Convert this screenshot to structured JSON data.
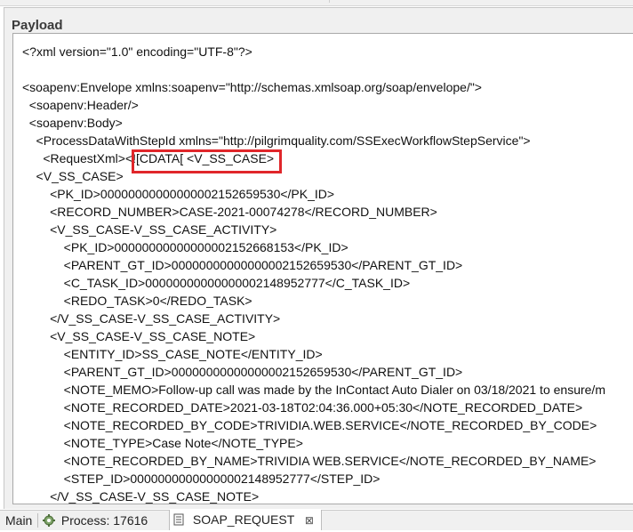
{
  "panel": {
    "title": "Payload"
  },
  "payload_lines": [
    "<?xml version=\"1.0\" encoding=\"UTF-8\"?>",
    "",
    "<soapenv:Envelope xmlns:soapenv=\"http://schemas.xmlsoap.org/soap/envelope/\">",
    "  <soapenv:Header/>",
    "  <soapenv:Body>",
    "    <ProcessDataWithStepId xmlns=\"http://pilgrimquality.com/SSExecWorkflowStepService\">",
    "      <RequestXml><![CDATA[ <V_SS_CASE>",
    "    <V_SS_CASE>",
    "        <PK_ID>00000000000000002152659530</PK_ID>",
    "        <RECORD_NUMBER>CASE-2021-00074278</RECORD_NUMBER>",
    "        <V_SS_CASE-V_SS_CASE_ACTIVITY>",
    "            <PK_ID>00000000000000002152668153</PK_ID>",
    "            <PARENT_GT_ID>00000000000000002152659530</PARENT_GT_ID>",
    "            <C_TASK_ID>00000000000000002148952777</C_TASK_ID>",
    "            <REDO_TASK>0</REDO_TASK>",
    "        </V_SS_CASE-V_SS_CASE_ACTIVITY>",
    "        <V_SS_CASE-V_SS_CASE_NOTE>",
    "            <ENTITY_ID>SS_CASE_NOTE</ENTITY_ID>",
    "            <PARENT_GT_ID>00000000000000002152659530</PARENT_GT_ID>",
    "            <NOTE_MEMO>Follow-up call was made by the InContact Auto Dialer on 03/18/2021 to ensure/m",
    "            <NOTE_RECORDED_DATE>2021-03-18T02:04:36.000+05:30</NOTE_RECORDED_DATE>",
    "            <NOTE_RECORDED_BY_CODE>TRIVIDIA.WEB.SERVICE</NOTE_RECORDED_BY_CODE>",
    "            <NOTE_TYPE>Case Note</NOTE_TYPE>",
    "            <NOTE_RECORDED_BY_NAME>TRIVIDIA WEB.SERVICE</NOTE_RECORDED_BY_NAME>",
    "            <STEP_ID>00000000000000002148952777</STEP_ID>",
    "        </V_SS_CASE-V_SS_CASE_NOTE>"
  ],
  "status_bar": {
    "main_label": "Main",
    "process_label": "Process: 17616",
    "soap_label": "SOAP_REQUEST",
    "close_glyph": "⊠"
  },
  "colors": {
    "highlight": "#e0262a"
  },
  "icons": {
    "process": "gear-icon",
    "soap": "document-icon",
    "close": "close-icon"
  }
}
